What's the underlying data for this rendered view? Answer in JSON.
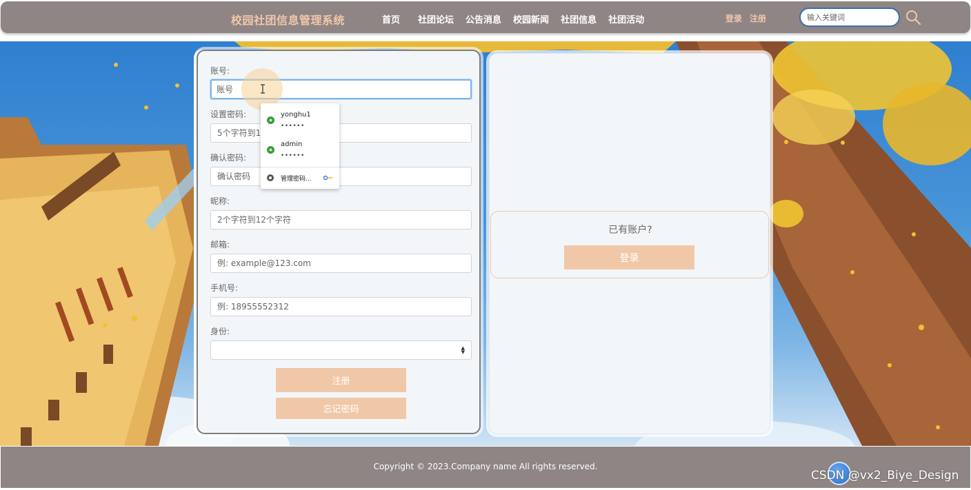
{
  "header": {
    "site_title": "校园社团信息管理系统",
    "nav": [
      "首页",
      "社团论坛",
      "公告消息",
      "校园新闻",
      "社团信息",
      "社团活动"
    ],
    "login_link": "登录",
    "register_link": "注册",
    "search_placeholder": "输入关键词"
  },
  "form": {
    "account": {
      "label": "账号:",
      "placeholder": "账号"
    },
    "password": {
      "label": "设置密码:",
      "placeholder": "5个字符到16个字符"
    },
    "confirm": {
      "label": "确认密码:",
      "placeholder": "确认密码"
    },
    "nickname": {
      "label": "昵称:",
      "placeholder": "2个字符到12个字符"
    },
    "email": {
      "label": "邮箱:",
      "placeholder": "例: example@123.com"
    },
    "phone": {
      "label": "手机号:",
      "placeholder": "例: 18955552312"
    },
    "identity": {
      "label": "身份:",
      "value": ""
    },
    "register_button": "注册",
    "forgot_button": "忘记密码"
  },
  "autofill": {
    "accounts": [
      {
        "username": "yonghu1",
        "password": "••••••"
      },
      {
        "username": "admin",
        "password": "••••••"
      }
    ],
    "manage": "管理密码..."
  },
  "side_panel": {
    "question": "已有账户?",
    "login_button": "登录"
  },
  "footer": {
    "copyright": "Copyright © 2023.Company name All rights reserved."
  },
  "watermark": "CSDN @vx2_Biye_Design",
  "colors": {
    "header_bg": "#8f8585",
    "accent": "#f0c8a8",
    "panel_bg": "#f3f6f9"
  }
}
